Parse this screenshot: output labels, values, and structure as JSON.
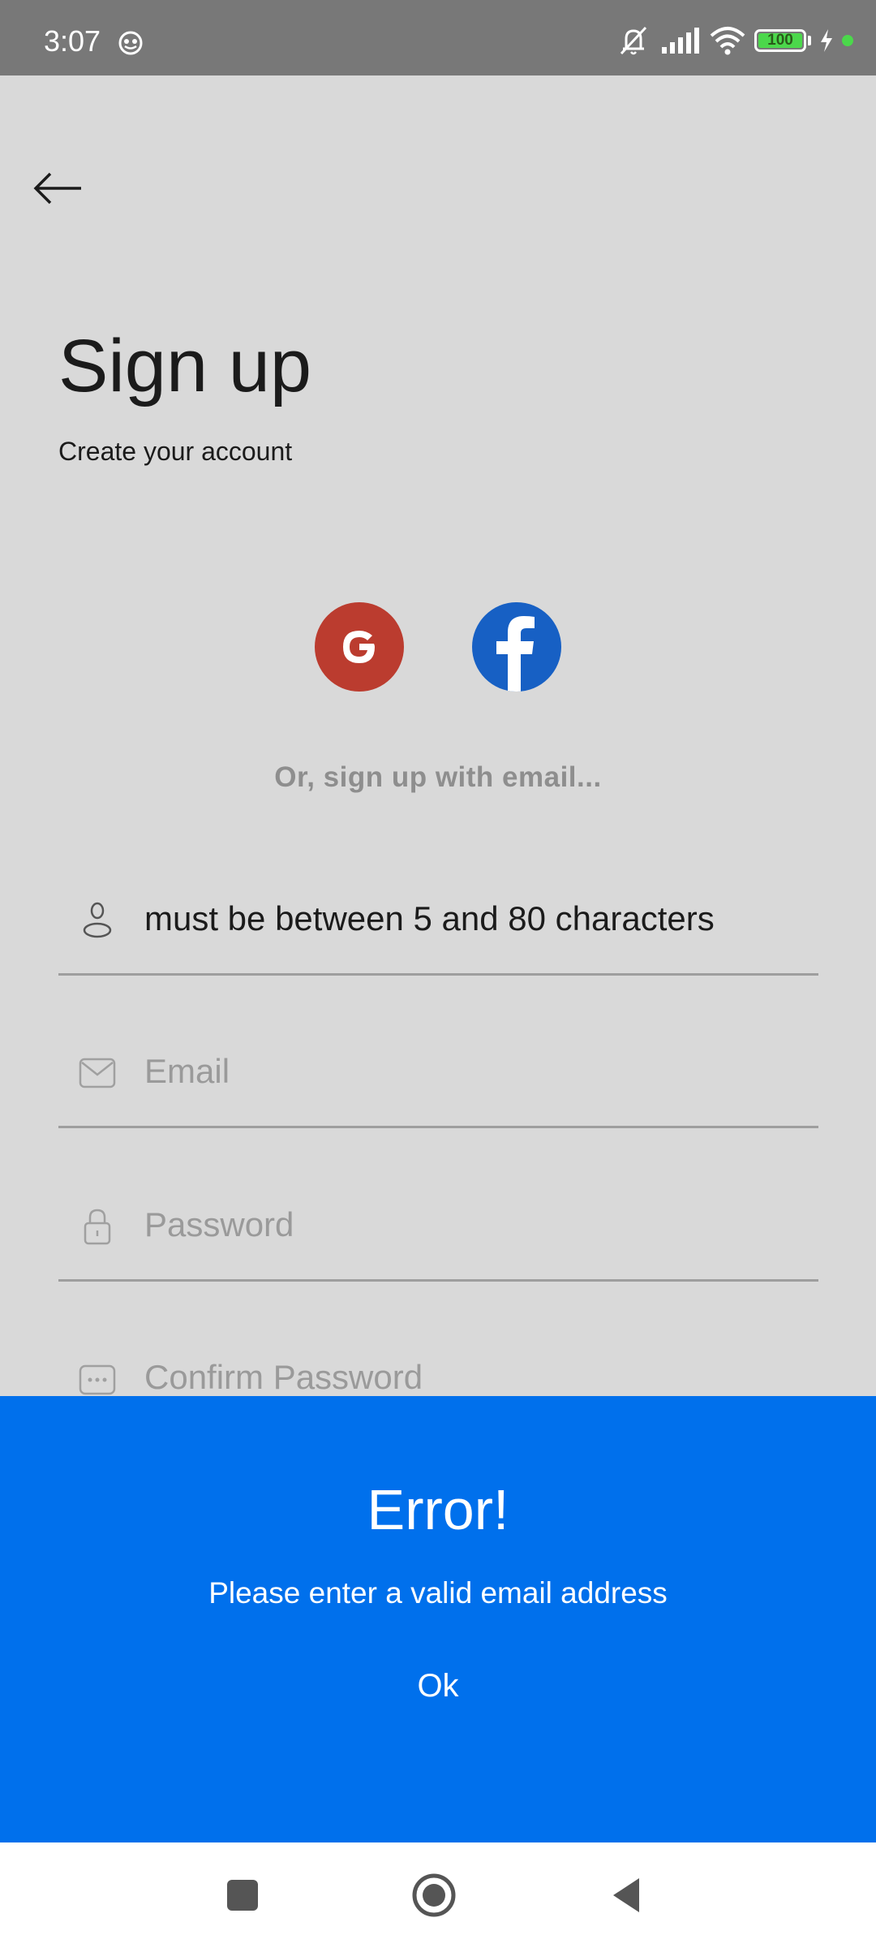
{
  "status_bar": {
    "time": "3:07",
    "battery_level": "100",
    "accent_battery": "#4bd84b"
  },
  "page": {
    "title": "Sign up",
    "subtitle": "Create your account",
    "divider_text": "Or, sign up with email..."
  },
  "social": {
    "google_icon": "google-icon",
    "google_color": "#bb3c2f",
    "facebook_icon": "facebook-icon",
    "facebook_color": "#1760c4"
  },
  "form": {
    "name_value": "must be between 5 and 80 characters",
    "email_placeholder": "Email",
    "password_placeholder": "Password",
    "confirm_password_placeholder": "Confirm Password"
  },
  "dialog": {
    "title": "Error!",
    "message": "Please enter a valid email address",
    "ok_label": "Ok",
    "background_color": "#0070ec"
  }
}
